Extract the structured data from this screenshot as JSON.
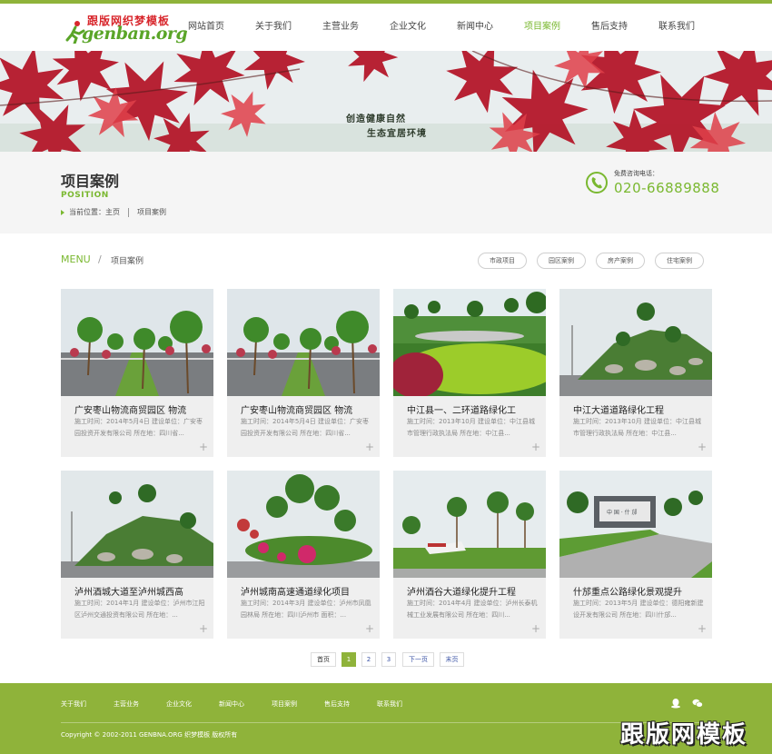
{
  "header": {
    "logo_cn": "跟版网织梦模板",
    "logo_en": "genban.org",
    "nav": [
      {
        "label": "网站首页",
        "active": false
      },
      {
        "label": "关于我们",
        "active": false
      },
      {
        "label": "主营业务",
        "active": false
      },
      {
        "label": "企业文化",
        "active": false
      },
      {
        "label": "新闻中心",
        "active": false
      },
      {
        "label": "项目案例",
        "active": true
      },
      {
        "label": "售后支持",
        "active": false
      },
      {
        "label": "联系我们",
        "active": false
      }
    ]
  },
  "banner": {
    "slogan1": "创造健康自然",
    "slogan2": "生态宜居环境"
  },
  "position": {
    "title": "项目案例",
    "subtitle": "POSITION",
    "crumb_prefix": "当前位置：主页",
    "crumb_current": "项目案例",
    "phone_label": "免费咨询电话：",
    "phone": "020-66889888"
  },
  "menu": {
    "label": "MENU",
    "slash": "/",
    "current": "项目案例",
    "filters": [
      "市政项目",
      "园区案例",
      "房产案例",
      "住宅案例"
    ]
  },
  "cards": [
    {
      "title": "广安枣山物流商贸园区 物流",
      "desc": "施工时间：2014年5月4日 建设单位：广安枣园投资开发有限公司 所在地：四川省..."
    },
    {
      "title": "广安枣山物流商贸园区 物流",
      "desc": "施工时间：2014年5月4日 建设单位：广安枣园投资开发有限公司 所在地：四川省..."
    },
    {
      "title": "中江县一、二环道路绿化工",
      "desc": "施工时间：2013年10月 建设单位：中江县城市管理行政执法局 所在地：中江县..."
    },
    {
      "title": "中江大道道路绿化工程",
      "desc": "施工时间：2013年10月 建设单位：中江县城市管理行政执法局 所在地：中江县..."
    },
    {
      "title": "泸州酒城大道至泸州城西高",
      "desc": "施工时间：2014年1月 建设单位：泸州市江阳区泸州交通投资有限公司 所在地：..."
    },
    {
      "title": "泸州城南高速通道绿化项目",
      "desc": "施工时间：2014年3月 建设单位：泸州市凤凰园林局 所在地：四川泸州市 面积：..."
    },
    {
      "title": "泸州酒谷大道绿化提升工程",
      "desc": "施工时间：2014年4月 建设单位：泸州长泰机械工业发展有限公司 所在地：四川..."
    },
    {
      "title": "什邡重点公路绿化景观提升",
      "desc": "施工时间：2013年5月 建设单位：德阳雍新建设开发有限公司 所在地：四川什邡..."
    }
  ],
  "pager": {
    "first": "首页",
    "pages": [
      "1",
      "2",
      "3"
    ],
    "next": "下一页",
    "last": "末页"
  },
  "footer": {
    "nav": [
      "关于我们",
      "主营业务",
      "企业文化",
      "新闻中心",
      "项目案例",
      "售后支持",
      "联系我们"
    ],
    "copyright": "Copyright © 2002-2011 GENBNA.ORG 织梦模板 版权所有",
    "watermark": "跟版网模板"
  },
  "colors": {
    "accent": "#8fb33a",
    "accent_text": "#7ab830"
  }
}
